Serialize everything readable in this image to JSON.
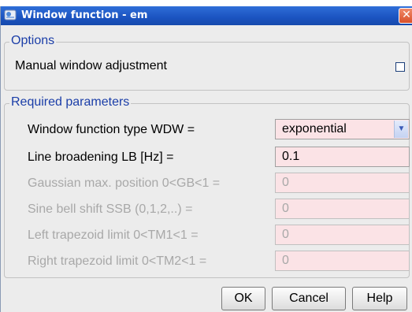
{
  "window": {
    "title": "Window function - em",
    "close_symbol": "✕",
    "title_icon": "app-window-icon"
  },
  "options": {
    "legend": "Options",
    "manual_adjustment_label": "Manual window adjustment",
    "manual_adjustment_checked": false
  },
  "required": {
    "legend": "Required parameters",
    "rows": [
      {
        "label": "Window function type WDW =",
        "value": "exponential",
        "enabled": true,
        "type": "dropdown"
      },
      {
        "label": "Line broadening LB [Hz] =",
        "value": "0.1",
        "enabled": true,
        "type": "text"
      },
      {
        "label": "Gaussian max. position 0<GB<1 =",
        "value": "0",
        "enabled": false,
        "type": "text"
      },
      {
        "label": "Sine bell shift SSB (0,1,2,..) =",
        "value": "0",
        "enabled": false,
        "type": "text"
      },
      {
        "label": "Left trapezoid limit 0<TM1<1 =",
        "value": "0",
        "enabled": false,
        "type": "text"
      },
      {
        "label": "Right trapezoid limit 0<TM2<1 =",
        "value": "0",
        "enabled": false,
        "type": "text"
      }
    ]
  },
  "buttons": {
    "ok": "OK",
    "cancel": "Cancel",
    "help": "Help"
  },
  "colors": {
    "title_bar": "#1b53c0",
    "legend_text": "#1b3ea8",
    "field_background": "#fbe3e6",
    "disabled_text": "#a8a8a8"
  }
}
